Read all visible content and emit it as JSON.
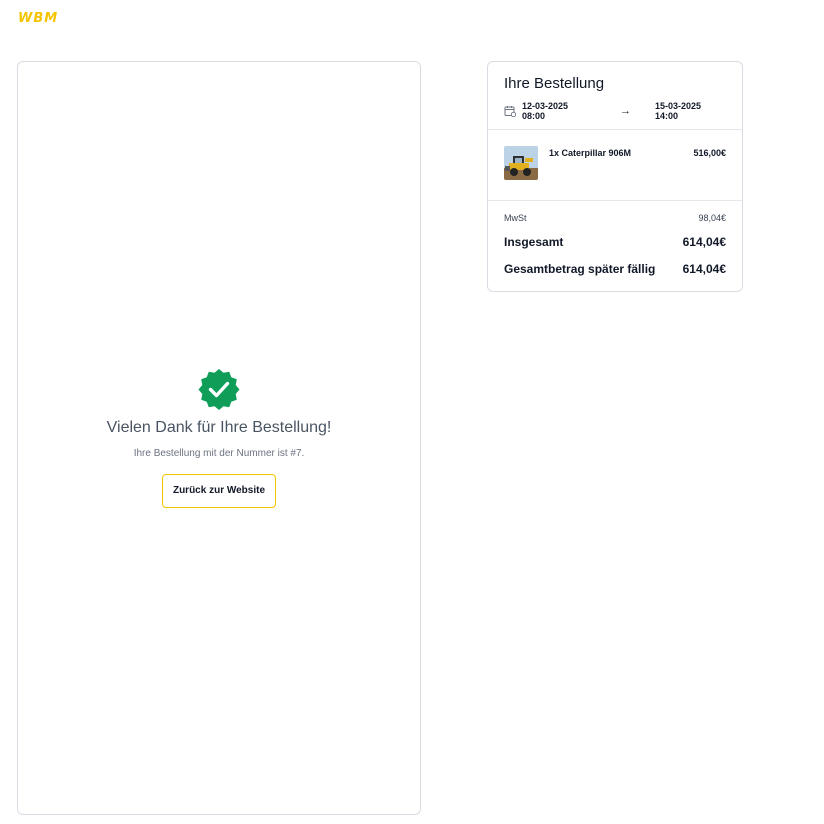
{
  "header": {
    "logo_text": "WBM"
  },
  "confirmation": {
    "title": "Vielen Dank für Ihre Bestellung!",
    "order_number_text": "Ihre Bestellung mit der Nummer ist #7.",
    "back_button_label": "Zurück zur Website"
  },
  "order": {
    "title": "Ihre Bestellung",
    "start": "12-03-2025 08:00",
    "end": "15-03-2025 14:00",
    "items": [
      {
        "name": "1x Caterpillar 906M",
        "price": "516,00€"
      }
    ],
    "vat_label": "MwSt",
    "vat_value": "98,04€",
    "total_label": "Insgesamt",
    "total_value": "614,04€",
    "due_label": "Gesamtbetrag später fällig",
    "due_value": "614,04€"
  },
  "colors": {
    "brand": "#f5c400",
    "success": "#0f9d58"
  },
  "icons": {
    "badge": "check-badge-icon",
    "calendar": "calendar-icon",
    "arrow": "arrow-right-icon"
  }
}
